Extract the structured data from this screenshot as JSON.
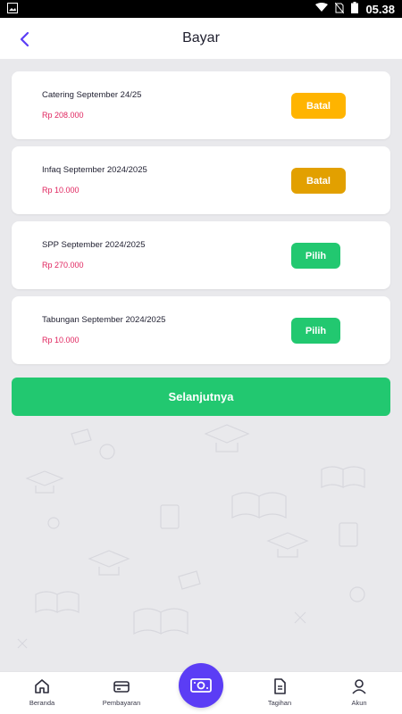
{
  "status_bar": {
    "time": "05.38"
  },
  "header": {
    "title": "Bayar"
  },
  "items": [
    {
      "name": "Catering September 24/25",
      "price": "Rp 208.000",
      "action": "Batal"
    },
    {
      "name": "Infaq September 2024/2025",
      "price": "Rp 10.000",
      "action": "Batal"
    },
    {
      "name": "SPP September 2024/2025",
      "price": "Rp 270.000",
      "action": "Pilih"
    },
    {
      "name": "Tabungan September 2024/2025",
      "price": "Rp 10.000",
      "action": "Pilih"
    }
  ],
  "next_button": "Selanjutnya",
  "nav": {
    "beranda": "Beranda",
    "pembayaran": "Pembayaran",
    "tagihan": "Tagihan",
    "akun": "Akun"
  },
  "colors": {
    "accent": "#5b3df5",
    "green": "#22c870",
    "orange": "#ffb400",
    "price": "#e0245e"
  },
  "icons": [
    "image-icon",
    "wifi-icon",
    "no-sim-icon",
    "battery-icon",
    "back-arrow-icon",
    "home-icon",
    "card-icon",
    "money-icon",
    "document-icon",
    "user-icon"
  ]
}
